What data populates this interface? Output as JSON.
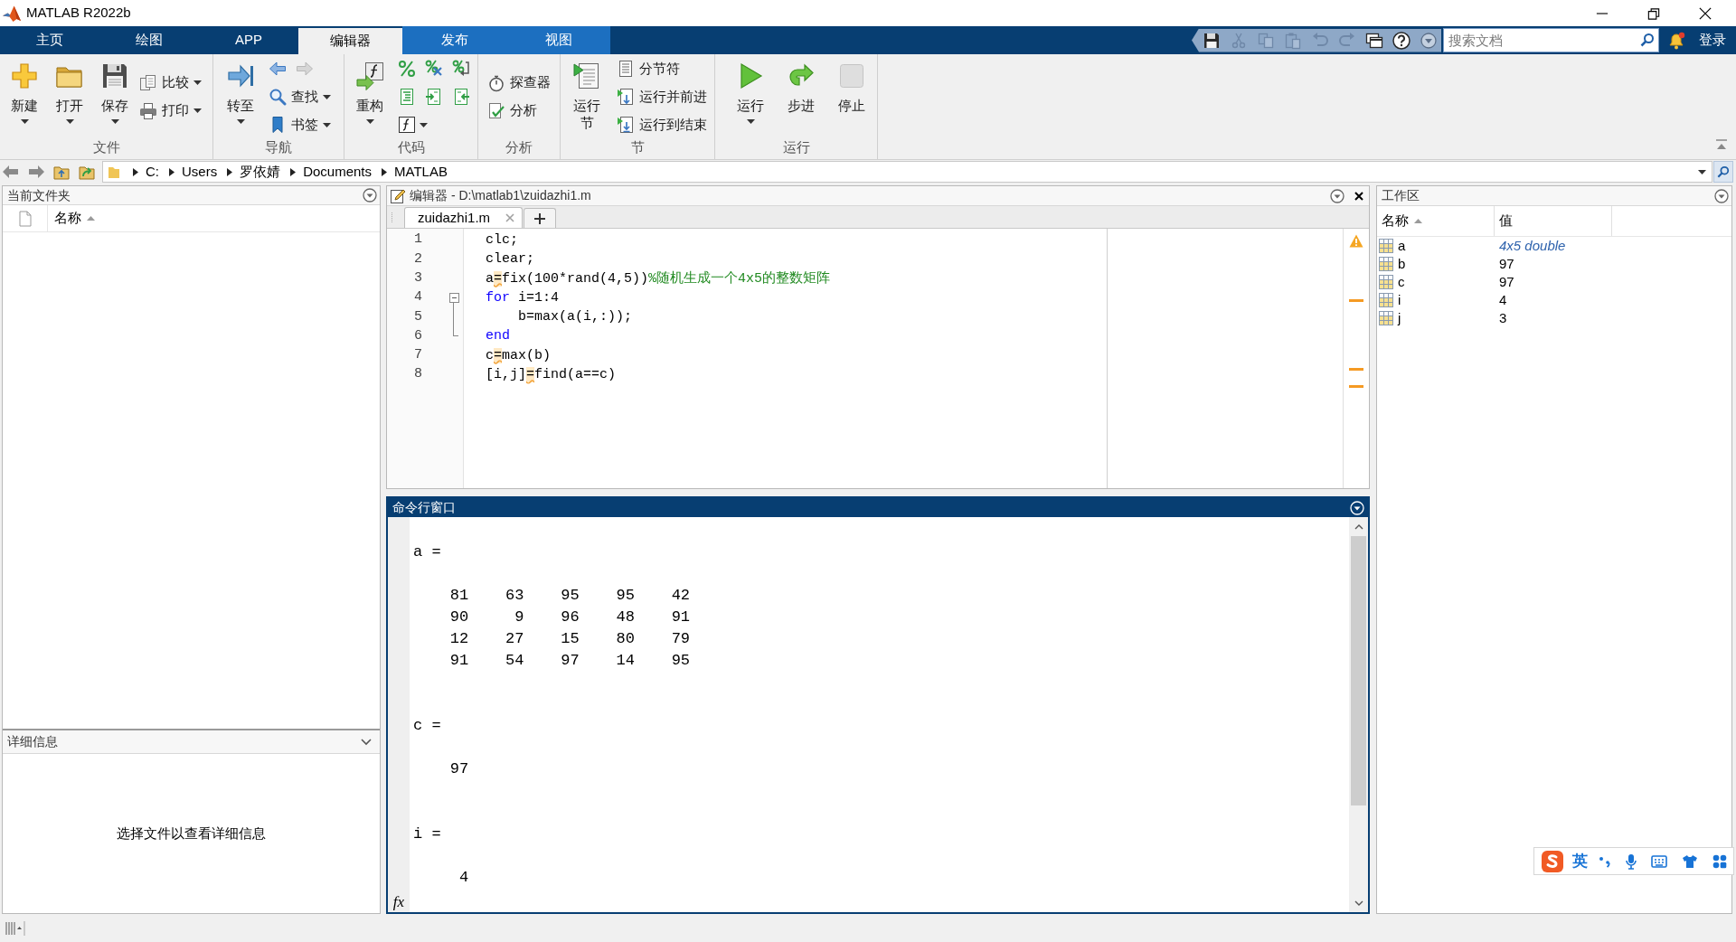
{
  "window": {
    "title": "MATLAB R2022b"
  },
  "tabs": [
    {
      "label": "主页",
      "selected": false,
      "contextual": false
    },
    {
      "label": "绘图",
      "selected": false,
      "contextual": false
    },
    {
      "label": "APP",
      "selected": false,
      "contextual": false
    },
    {
      "label": "编辑器",
      "selected": true,
      "contextual": true
    },
    {
      "label": "发布",
      "selected": false,
      "contextual": true
    },
    {
      "label": "视图",
      "selected": false,
      "contextual": true
    }
  ],
  "quick_access": [
    {
      "disabled": false
    },
    {
      "disabled": true
    },
    {
      "disabled": true
    },
    {
      "disabled": true
    },
    {
      "disabled": true
    },
    {
      "disabled": true
    },
    {
      "disabled": false
    },
    {
      "disabled": false
    }
  ],
  "search": {
    "placeholder": "搜索文档"
  },
  "sign_in": "登录",
  "ribbon": {
    "groups": [
      {
        "label": "文件",
        "buttons": [
          {
            "kind": "large",
            "label": "新建",
            "dropdown": true
          },
          {
            "kind": "large",
            "label": "打开",
            "dropdown": true
          },
          {
            "kind": "large",
            "label": "保存",
            "dropdown": true
          },
          {
            "kind": "small",
            "label": "比较",
            "dropdown": true
          },
          {
            "kind": "small",
            "label": "打印",
            "dropdown": true
          }
        ]
      },
      {
        "label": "导航",
        "buttons": [
          {
            "kind": "large",
            "label": "转至",
            "dropdown": true
          },
          {
            "kind": "icon",
            "disabled": false
          },
          {
            "kind": "icon",
            "disabled": true
          },
          {
            "kind": "small",
            "label": "查找",
            "dropdown": true
          },
          {
            "kind": "small",
            "label": "书签",
            "dropdown": true
          }
        ]
      },
      {
        "label": "代码",
        "buttons": [
          {
            "kind": "large",
            "label": "重构",
            "dropdown": true
          },
          {
            "kind": "icon"
          },
          {
            "kind": "icon"
          },
          {
            "kind": "icon"
          },
          {
            "kind": "icon"
          },
          {
            "kind": "icon"
          },
          {
            "kind": "icon"
          },
          {
            "kind": "icon",
            "dropdown": true
          }
        ]
      },
      {
        "label": "分析",
        "buttons": [
          {
            "kind": "small",
            "label": "探查器"
          },
          {
            "kind": "small",
            "label": "分析"
          }
        ]
      },
      {
        "label": "节",
        "buttons": [
          {
            "kind": "large",
            "label": "运行节"
          },
          {
            "kind": "small",
            "label": "分节符"
          },
          {
            "kind": "small",
            "label": "运行并前进"
          },
          {
            "kind": "small",
            "label": "运行到结束"
          }
        ]
      },
      {
        "label": "运行",
        "buttons": [
          {
            "kind": "large",
            "label": "运行",
            "dropdown": true
          },
          {
            "kind": "large",
            "label": "步进"
          },
          {
            "kind": "large",
            "label": "停止",
            "disabled": true
          }
        ]
      }
    ]
  },
  "address_bar": {
    "path": [
      "C:",
      "Users",
      "罗依婧",
      "Documents",
      "MATLAB"
    ]
  },
  "current_folder": {
    "title": "当前文件夹",
    "columns": [
      {
        "label": "名称",
        "sorted": true
      }
    ]
  },
  "details": {
    "title": "详细信息",
    "message": "选择文件以查看详细信息"
  },
  "editor": {
    "title": "编辑器 - D:\\matlab1\\zuidazhi1.m",
    "tabs": [
      {
        "label": "zuidazhi1.m",
        "selected": true
      }
    ],
    "lines": [
      {
        "number": "1",
        "segments": [
          {
            "kind": "code",
            "text": "clc;"
          }
        ]
      },
      {
        "number": "2",
        "segments": [
          {
            "kind": "code",
            "text": "clear;"
          }
        ]
      },
      {
        "number": "3",
        "segments": [
          {
            "kind": "code",
            "text": "a"
          },
          {
            "kind": "warning",
            "text": "="
          },
          {
            "kind": "code",
            "text": "fix(100*rand(4,5))"
          },
          {
            "kind": "comment",
            "text": "%随机生成一个4x5的整数矩阵"
          }
        ]
      },
      {
        "number": "4",
        "collapsible": true,
        "segments": [
          {
            "kind": "keyword",
            "text": "for"
          },
          {
            "kind": "code",
            "text": " i=1:4"
          }
        ]
      },
      {
        "number": "5",
        "in_block": true,
        "segments": [
          {
            "kind": "code",
            "text": "    b=max(a(i,:));"
          }
        ]
      },
      {
        "number": "6",
        "in_block": true,
        "block_end": true,
        "segments": [
          {
            "kind": "keyword",
            "text": "end"
          }
        ]
      },
      {
        "number": "7",
        "segments": [
          {
            "kind": "code",
            "text": "c"
          },
          {
            "kind": "warning",
            "text": "="
          },
          {
            "kind": "code",
            "text": "max(b)"
          }
        ]
      },
      {
        "number": "8",
        "segments": [
          {
            "kind": "code",
            "text": "[i,j]"
          },
          {
            "kind": "warning",
            "text": "="
          },
          {
            "kind": "code",
            "text": "find(a==c)"
          }
        ]
      }
    ]
  },
  "command_window": {
    "title": "命令行窗口",
    "prompt_icon": "fx",
    "outputs": [
      {
        "header": "a =",
        "rows": [
          "    81    63    95    95    42",
          "    90     9    96    48    91",
          "    12    27    15    80    79",
          "    91    54    97    14    95"
        ]
      },
      {
        "header": "c =",
        "rows": [
          "    97"
        ]
      },
      {
        "header": "i =",
        "rows": [
          "     4"
        ]
      }
    ]
  },
  "workspace": {
    "title": "工作区",
    "columns": [
      {
        "label": "名称",
        "sorted": true
      },
      {
        "label": "值"
      }
    ],
    "variables": [
      {
        "name": "a",
        "value": "4x5 double",
        "kind": "matrix"
      },
      {
        "name": "b",
        "value": "97",
        "kind": "scalar"
      },
      {
        "name": "c",
        "value": "97",
        "kind": "scalar"
      },
      {
        "name": "i",
        "value": "4",
        "kind": "scalar"
      },
      {
        "name": "j",
        "value": "3",
        "kind": "scalar"
      }
    ]
  },
  "ime_bar": {
    "mode": "英"
  }
}
